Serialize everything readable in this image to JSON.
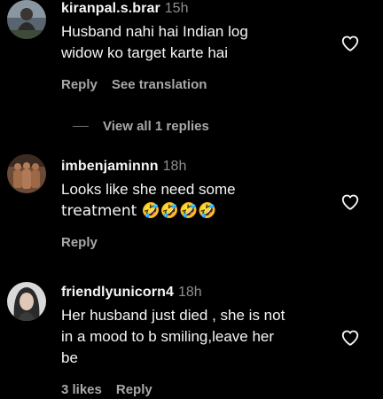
{
  "comments": [
    {
      "username": "kiranpal.s.brar",
      "time": "15h",
      "text_lines": [
        "Husband nahi hai Indian log",
        "widow ko target karte hai"
      ],
      "actions": {
        "reply": "Reply",
        "translate": "See translation"
      },
      "view_replies": "View all 1 replies"
    },
    {
      "username": "imbenjaminnn",
      "time": "18h",
      "text_lines": [
        "Looks like she need some",
        "treatment 🤣🤣🤣🤣"
      ],
      "actions": {
        "reply": "Reply"
      }
    },
    {
      "username": "friendlyunicorn4",
      "time": "18h",
      "text_lines": [
        "Her husband just died , she is not",
        "in a mood to b smiling,leave her",
        "be"
      ],
      "actions": {
        "likes": "3 likes",
        "reply": "Reply"
      }
    }
  ],
  "colors": {
    "background": "#000000",
    "primary_text": "#f5f5f5",
    "secondary_text": "#a8a8a8",
    "time_text": "#8e8e8e"
  },
  "icons": {
    "like": "heart-outline-icon"
  }
}
